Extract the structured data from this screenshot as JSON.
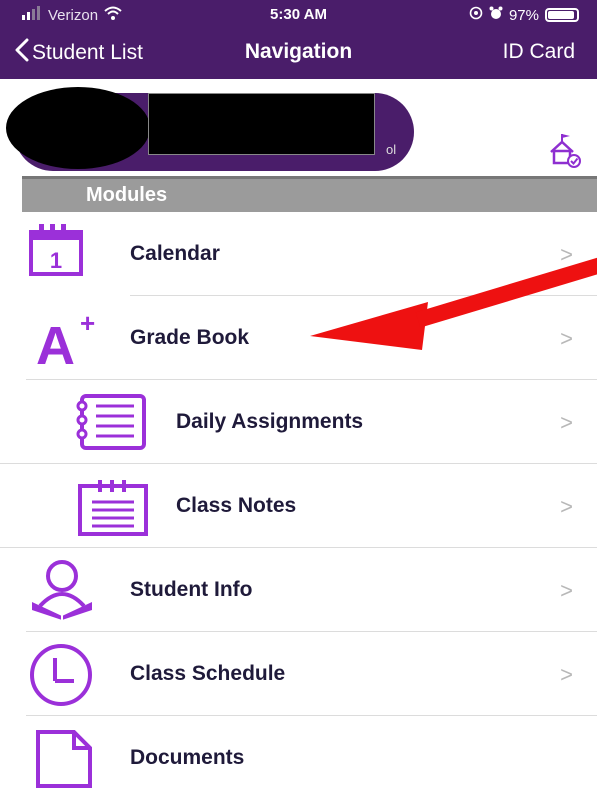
{
  "status_bar": {
    "carrier": "Verizon",
    "time": "5:30 AM",
    "battery": "97%",
    "battery_level": 0.97
  },
  "nav": {
    "back_label": "Student List",
    "title": "Navigation",
    "right_label": "ID Card"
  },
  "student": {
    "school_tail": "ol"
  },
  "modules": {
    "header": "Modules",
    "items": [
      {
        "label": "Calendar",
        "icon": "calendar-icon"
      },
      {
        "label": "Grade Book",
        "icon": "grade-book-icon"
      },
      {
        "label": "Daily Assignments",
        "icon": "assignments-icon"
      },
      {
        "label": "Class Notes",
        "icon": "class-notes-icon"
      },
      {
        "label": "Student Info",
        "icon": "student-info-icon"
      },
      {
        "label": "Class Schedule",
        "icon": "clock-icon"
      },
      {
        "label": "Documents",
        "icon": "document-icon"
      }
    ],
    "chevron": ">"
  },
  "colors": {
    "brand_purple": "#4a1d6a",
    "icon_purple": "#9b30d9",
    "header_gray": "#9b9b9b",
    "annotation_red": "#ee1111"
  }
}
